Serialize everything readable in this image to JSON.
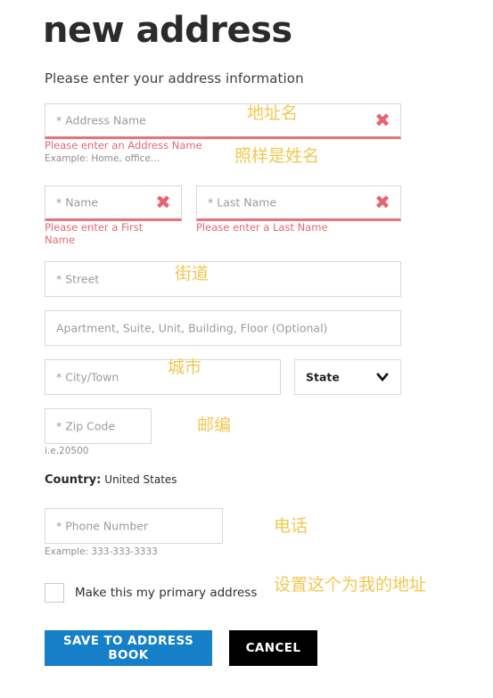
{
  "header": {
    "title": "new address",
    "subtitle": "Please enter your address information"
  },
  "colors": {
    "accent_blue": "#1580c8",
    "cancel_black": "#000000",
    "error_red": "#e8636f",
    "annotation_gold": "#f0c850",
    "border_gray": "#d8d8d8",
    "placeholder_gray": "#9b9b9b"
  },
  "form": {
    "address_name": {
      "placeholder": "* Address Name",
      "error": "Please enter an Address Name",
      "hint": "Example: Home, office...",
      "icon": "error-x-icon",
      "state": "error"
    },
    "first_name": {
      "placeholder": "* Name",
      "error": "Please enter a First Name",
      "icon": "error-x-icon",
      "state": "error"
    },
    "last_name": {
      "placeholder": "* Last Name",
      "error": "Please enter a Last Name",
      "icon": "error-x-icon",
      "state": "error"
    },
    "street": {
      "placeholder": "* Street"
    },
    "apartment": {
      "placeholder": "Apartment, Suite, Unit, Building, Floor (Optional)"
    },
    "city": {
      "placeholder": "* City/Town"
    },
    "state_select": {
      "selected": "State",
      "icon": "chevron-down-icon"
    },
    "zip": {
      "placeholder": "* Zip Code",
      "hint": "i.e.20500"
    },
    "country": {
      "label": "Country:",
      "value": "United States"
    },
    "phone": {
      "placeholder": "* Phone Number",
      "hint": "Example: 333-333-3333"
    },
    "primary_checkbox": {
      "label": "Make this my primary address",
      "checked": false
    }
  },
  "actions": {
    "save_label": "SAVE TO ADDRESS BOOK",
    "cancel_label": "CANCEL"
  },
  "annotations": [
    {
      "text": "地址名"
    },
    {
      "text": "照样是姓名"
    },
    {
      "text": "街道"
    },
    {
      "text": "城市"
    },
    {
      "text": "邮编"
    },
    {
      "text": "电话"
    },
    {
      "text": "设置这个为我的地址"
    }
  ]
}
